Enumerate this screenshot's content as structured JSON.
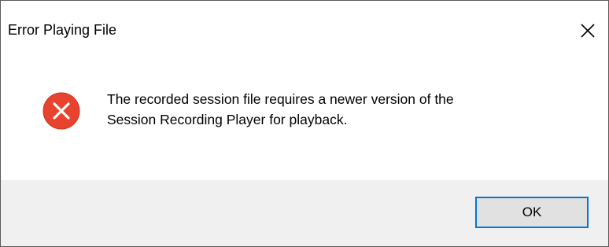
{
  "dialog": {
    "title": "Error Playing File",
    "close_icon": "close-icon",
    "error_icon": "error-icon",
    "message_line1": "The recorded session file requires a newer version of the",
    "message_line2": "Session Recording Player for playback.",
    "ok_label": "OK"
  },
  "colors": {
    "error_red": "#e8432e",
    "button_focus_border": "#0078d7",
    "footer_bg": "#f0f0f0",
    "button_bg": "#e1e1e1"
  }
}
